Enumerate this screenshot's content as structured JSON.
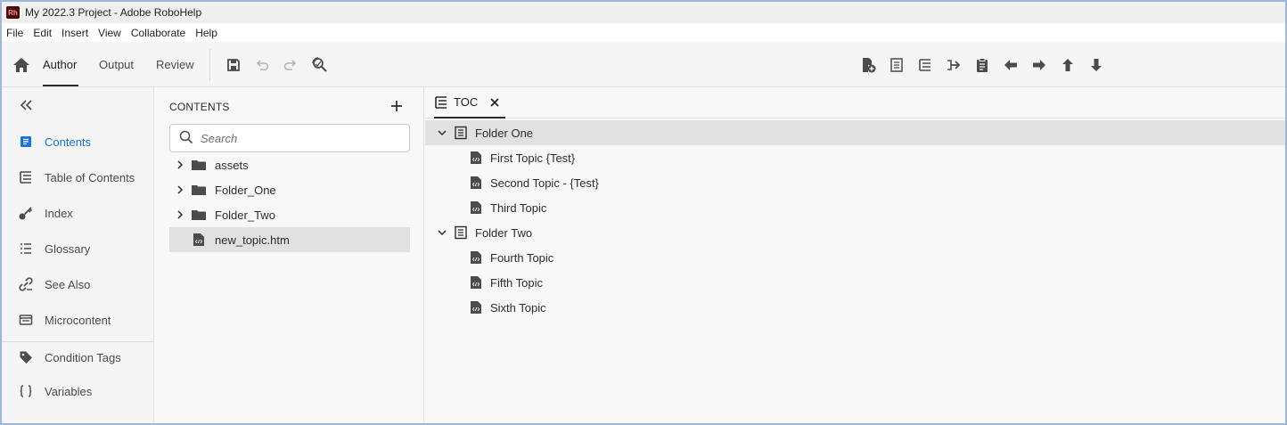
{
  "window": {
    "app_badge": "Rh",
    "title": "My 2022.3 Project - Adobe RoboHelp"
  },
  "menu": [
    "File",
    "Edit",
    "Insert",
    "View",
    "Collaborate",
    "Help"
  ],
  "toolbar": {
    "modes": [
      {
        "label": "Author",
        "active": true
      },
      {
        "label": "Output",
        "active": false
      },
      {
        "label": "Review",
        "active": false
      }
    ]
  },
  "left_rail": {
    "items": [
      {
        "label": "Contents",
        "icon": "contents-icon",
        "active": true
      },
      {
        "label": "Table of Contents",
        "icon": "toc-icon",
        "active": false
      },
      {
        "label": "Index",
        "icon": "key-icon",
        "active": false
      },
      {
        "label": "Glossary",
        "icon": "glossary-icon",
        "active": false
      },
      {
        "label": "See Also",
        "icon": "see-also-icon",
        "active": false
      },
      {
        "label": "Microcontent",
        "icon": "microcontent-icon",
        "active": false
      },
      {
        "label": "Condition Tags",
        "icon": "tag-icon",
        "active": false
      },
      {
        "label": "Variables",
        "icon": "braces-icon",
        "active": false
      }
    ]
  },
  "contents_panel": {
    "title": "CONTENTS",
    "search_placeholder": "Search",
    "items": [
      {
        "name": "assets",
        "type": "folder"
      },
      {
        "name": "Folder_One",
        "type": "folder"
      },
      {
        "name": "Folder_Two",
        "type": "folder"
      },
      {
        "name": "new_topic.htm",
        "type": "file",
        "selected": true
      }
    ]
  },
  "toc_panel": {
    "tab_label": "TOC",
    "tree": [
      {
        "label": "Folder One",
        "type": "book",
        "expanded": true,
        "selected": true
      },
      {
        "label": "First Topic {Test}",
        "type": "topic"
      },
      {
        "label": "Second Topic - {Test}",
        "type": "topic"
      },
      {
        "label": "Third Topic",
        "type": "topic"
      },
      {
        "label": "Folder Two",
        "type": "book",
        "expanded": true
      },
      {
        "label": "Fourth Topic",
        "type": "topic"
      },
      {
        "label": "Fifth Topic",
        "type": "topic"
      },
      {
        "label": "Sixth Topic",
        "type": "topic"
      }
    ]
  },
  "colors": {
    "accent": "#1473e6",
    "selection": "#e1e1e1",
    "icon": "#4b4b4b"
  }
}
